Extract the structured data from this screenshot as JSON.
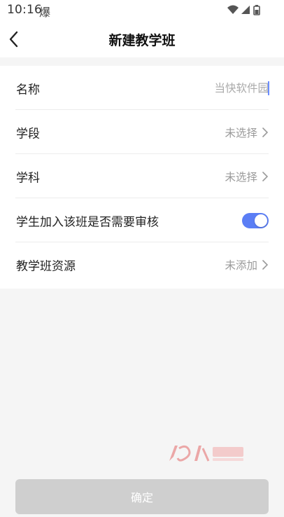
{
  "status_bar": {
    "time": "10:16",
    "app_icon_glyph": "爆",
    "icons": [
      "wifi-icon",
      "signal-icon",
      "battery-icon"
    ]
  },
  "header": {
    "title": "新建教学班",
    "back_icon": "chevron-left-icon"
  },
  "form": {
    "name": {
      "label": "名称",
      "placeholder": "当快软件园"
    },
    "stage": {
      "label": "学段",
      "value": "未选择"
    },
    "subject": {
      "label": "学科",
      "value": "未选择"
    },
    "review": {
      "label": "学生加入该班是否需要审核",
      "enabled": true
    },
    "resources": {
      "label": "教学班资源",
      "value": "未添加"
    }
  },
  "confirm_button": {
    "label": "确定"
  },
  "colors": {
    "accent": "#5b7ef5",
    "button_disabled": "#cfcfcf",
    "page_bg": "#f5f5f5",
    "muted_text": "#9a9a9a"
  }
}
